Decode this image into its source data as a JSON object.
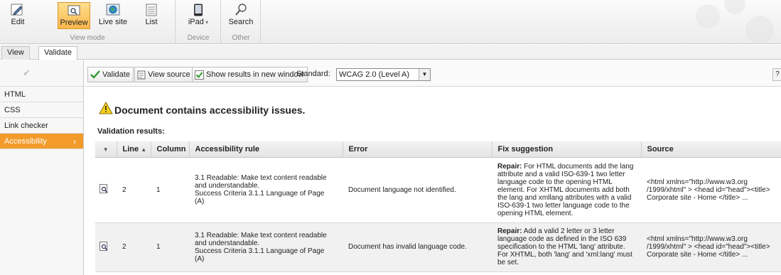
{
  "ribbon": {
    "view_mode": {
      "label": "View mode",
      "buttons": [
        {
          "label": "Edit",
          "icon": "edit-icon"
        },
        {
          "label": "Preview",
          "icon": "preview-icon",
          "active": true
        },
        {
          "label": "Live site",
          "icon": "live-site-icon"
        },
        {
          "label": "List",
          "icon": "list-icon"
        }
      ]
    },
    "device": {
      "label": "Device",
      "button": "iPad",
      "icon": "tablet-icon"
    },
    "other": {
      "label": "Other",
      "button": "Search",
      "icon": "search-icon"
    }
  },
  "tabs": [
    {
      "label": "View",
      "active": false
    },
    {
      "label": "Validate",
      "active": true
    }
  ],
  "sidebar": {
    "items": [
      {
        "label": "HTML"
      },
      {
        "label": "CSS"
      },
      {
        "label": "Link checker"
      },
      {
        "label": "Accessibility",
        "active": true
      }
    ]
  },
  "toolbar": {
    "validate": "Validate",
    "view_source": "View source",
    "show_results": "Show results in new window",
    "standard_label": "Standard:",
    "standard_value": "WCAG 2.0 (Level A)"
  },
  "status": {
    "message": "Document contains accessibility issues."
  },
  "results": {
    "label": "Validation results:",
    "columns": {
      "line": "Line",
      "column": "Column",
      "rule": "Accessibility rule",
      "error": "Error",
      "fix": "Fix suggestion",
      "source": "Source"
    },
    "rows": [
      {
        "line": "2",
        "column": "1",
        "rule": [
          "3.1 Readable: Make text content readable",
          "and understandable.",
          "Success Criteria 3.1.1 Language of Page",
          "(A)"
        ],
        "error": "Document language not identified.",
        "fix_prefix": "Repair:",
        "fix": [
          "For HTML documents add the lang",
          "attribute and a valid ISO-639-1 two letter",
          "language code to the opening HTML",
          "element. For XHTML documents add both",
          "the lang and xmllang attributes with a valid",
          "ISO-639-1 two letter language code to the",
          "opening HTML element."
        ],
        "source": [
          "<html xmlns=\"http://www.w3.org",
          "/1999/xhtml\" > <head id=\"head\"><title>",
          "Corporate site - Home </title> ..."
        ]
      },
      {
        "line": "2",
        "column": "1",
        "rule": [
          "3.1 Readable: Make text content readable",
          "and understandable.",
          "Success Criteria 3.1.1 Language of Page",
          "(A)"
        ],
        "error": "Document has invalid language code.",
        "fix_prefix": "Repair:",
        "fix": [
          "Add a valid 2 letter or 3 letter",
          "language code as defined in the ISO 639",
          "specification to the HTML 'lang' attribute.",
          "For XHTML, both 'lang' and 'xml:lang' must",
          "be set."
        ],
        "source": [
          "<html xmlns=\"http://www.w3.org",
          "/1999/xhtml\" > <head id=\"head\"><title>",
          "Corporate site - Home </title> ..."
        ]
      }
    ]
  },
  "colors": {
    "active_orange": "#f29b2a",
    "preview_highlight": "#f9b64c",
    "ribbon_bg": "#ececec",
    "warning_yellow": "#f5d21e"
  }
}
